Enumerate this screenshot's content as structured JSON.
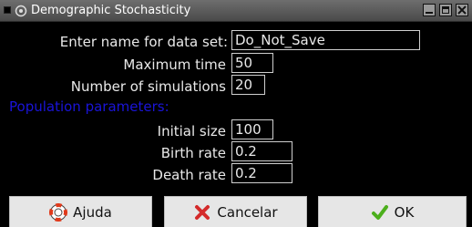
{
  "window": {
    "title": "Demographic Stochasticity"
  },
  "form": {
    "dataset_label": "Enter name for data set:",
    "dataset_value": "Do_Not_Save",
    "max_time_label": "Maximum time",
    "max_time_value": "50",
    "num_sims_label": "Number of simulations",
    "num_sims_value": "20",
    "section_label": "Population parameters:",
    "initial_size_label": "Initial size",
    "initial_size_value": "100",
    "birth_rate_label": "Birth rate",
    "birth_rate_value": "0.2",
    "death_rate_label": "Death rate",
    "death_rate_value": "0.2"
  },
  "buttons": {
    "help_label": "Ajuda",
    "cancel_label": "Cancelar",
    "ok_label": "OK"
  },
  "colors": {
    "background": "#000000",
    "section_title": "#1a14d8",
    "button_face": "#e6e6e6",
    "cancel_icon": "#d42a2a",
    "ok_icon": "#4caf1c"
  }
}
